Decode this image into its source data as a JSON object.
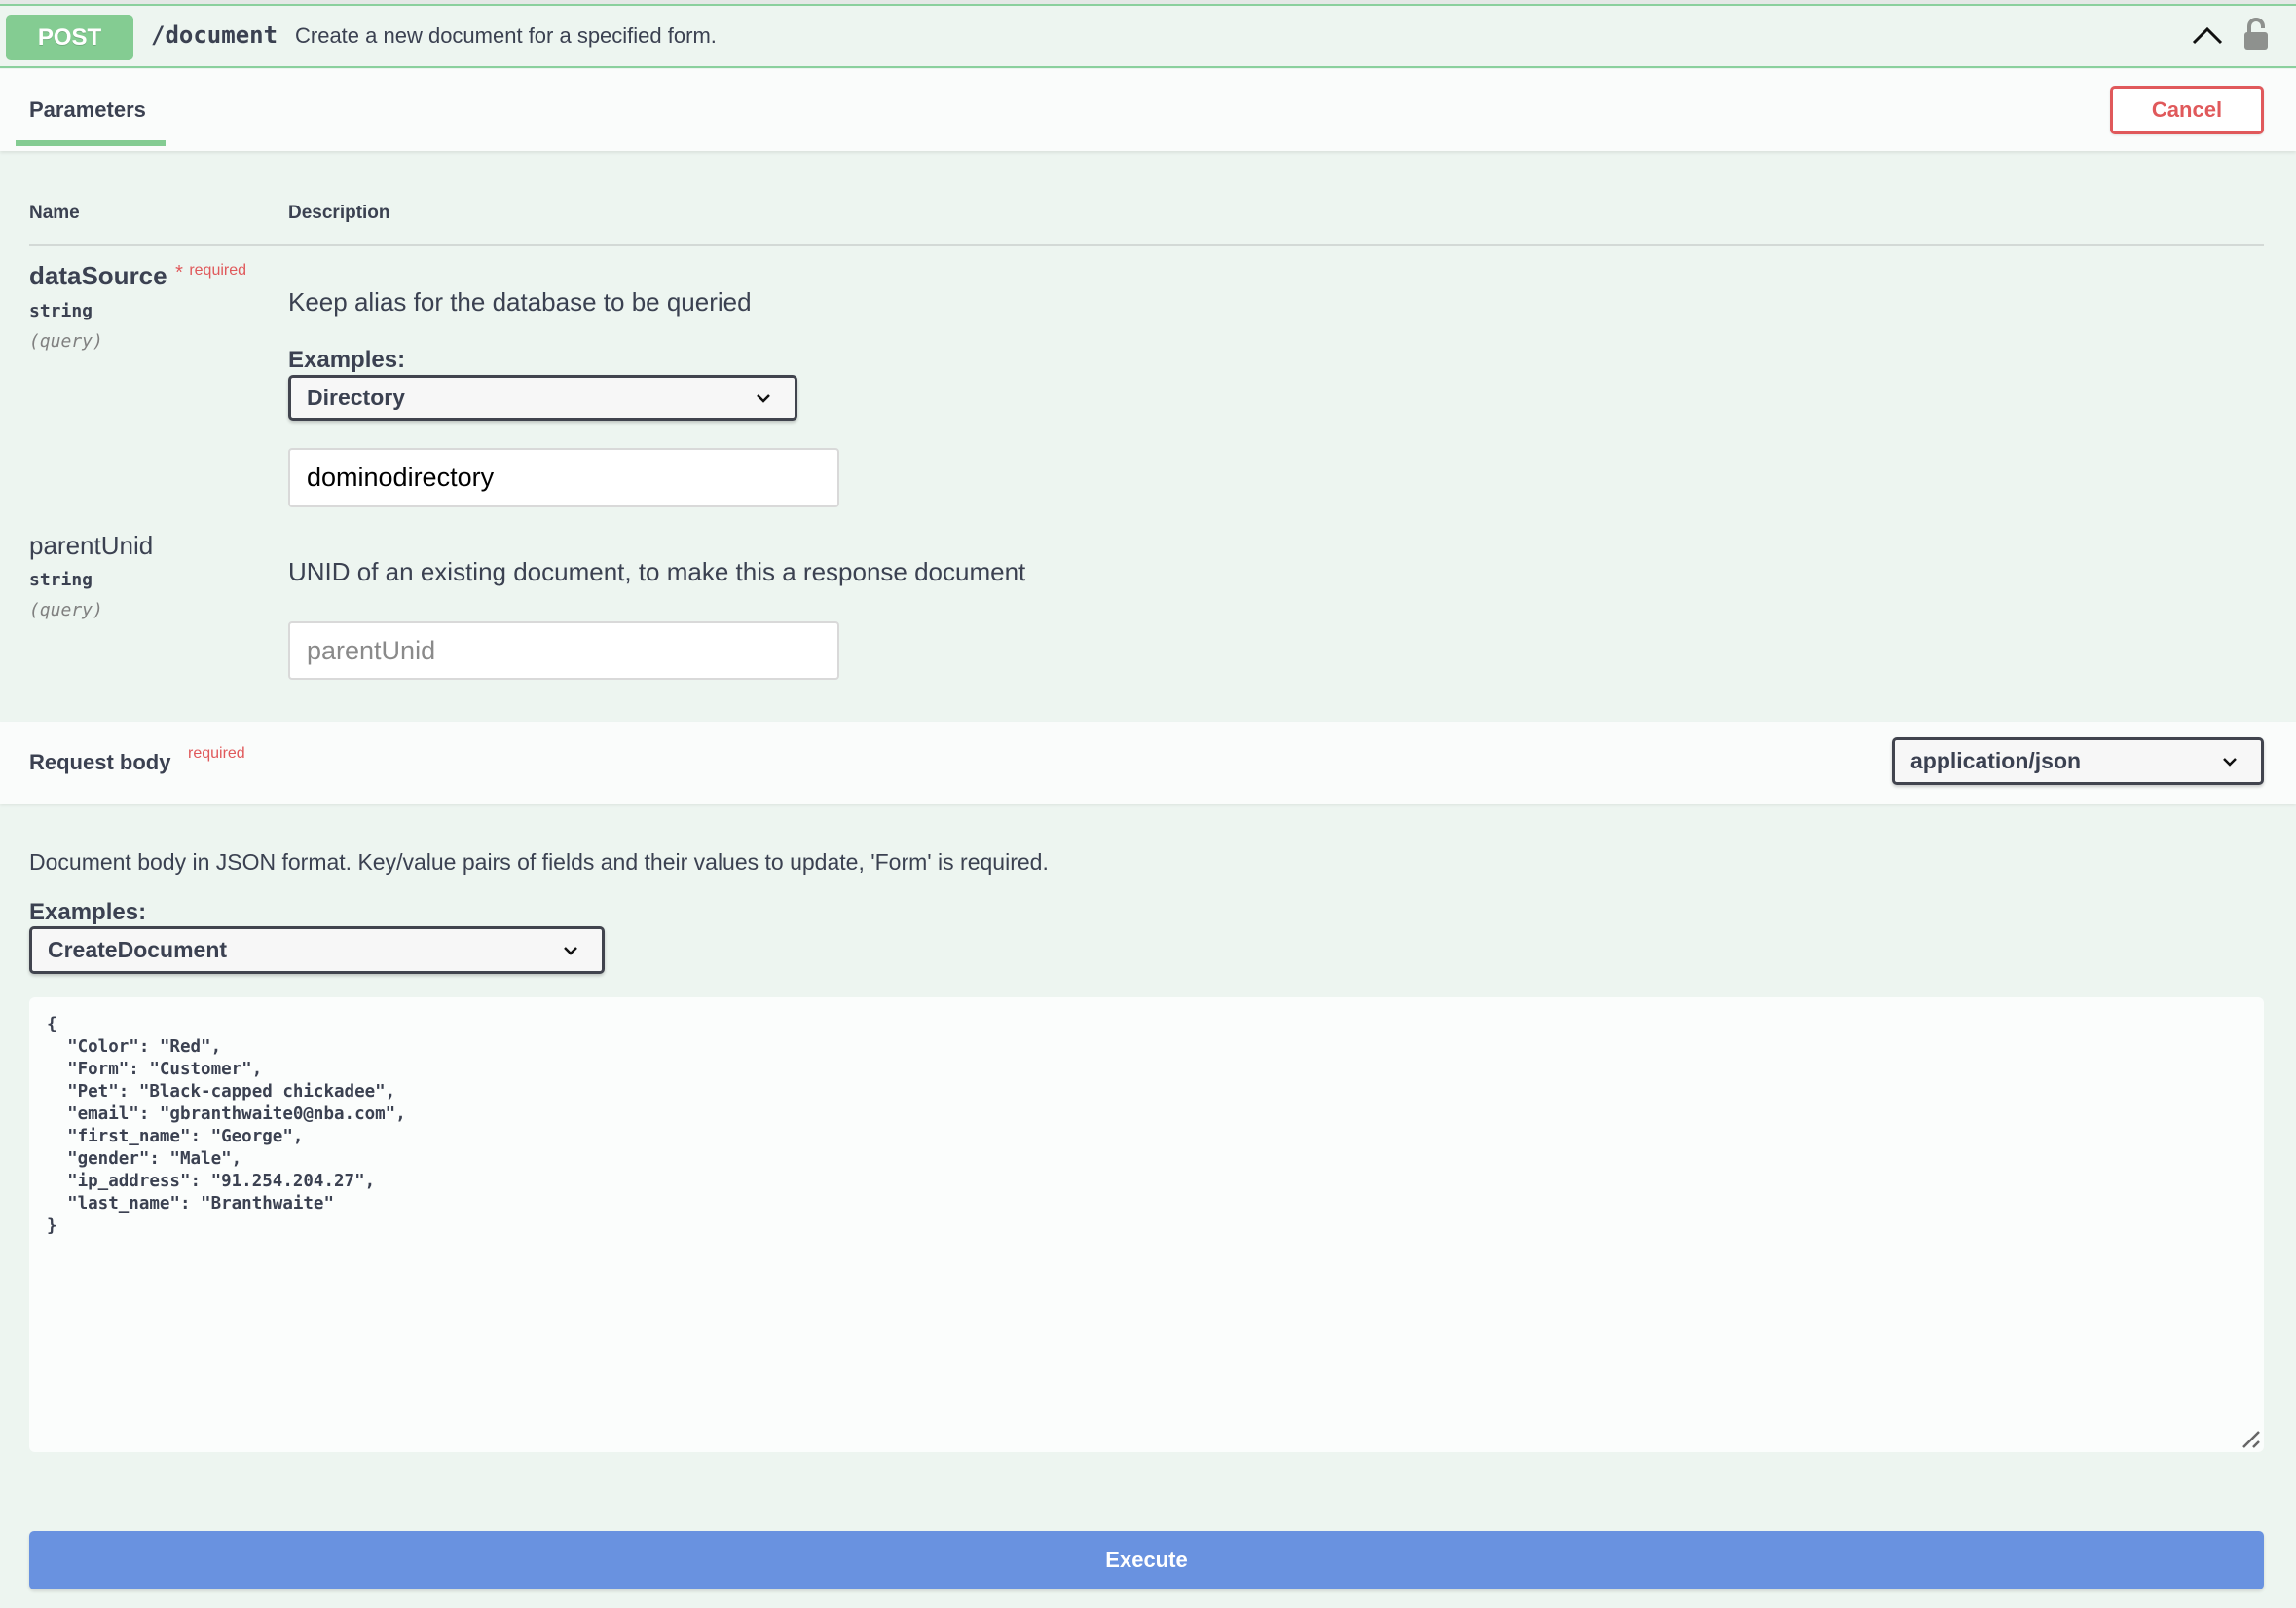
{
  "operation": {
    "method": "POST",
    "path": "/document",
    "summary": "Create a new document for a specified form.",
    "method_color": "#84cc92",
    "collapse_icon": "chevron-up-icon",
    "lock_icon": "lock-icon"
  },
  "tabs": {
    "parameters_label": "Parameters",
    "cancel_label": "Cancel"
  },
  "table": {
    "col_name": "Name",
    "col_description": "Description"
  },
  "parameters": [
    {
      "name": "dataSource",
      "required_star": "*",
      "required_label": "required",
      "type": "string",
      "in": "(query)",
      "description": "Keep alias for the database to be queried",
      "examples_label": "Examples:",
      "example_selected": "Directory",
      "value": "dominodirectory"
    },
    {
      "name": "parentUnid",
      "type": "string",
      "in": "(query)",
      "description": "UNID of an existing document, to make this a response document",
      "placeholder": "parentUnid",
      "value": ""
    }
  ],
  "request_body": {
    "title": "Request body",
    "required_label": "required",
    "content_type": "application/json",
    "description": "Document body in JSON format. Key/value pairs of fields and their values to update, 'Form' is required.",
    "examples_label": "Examples:",
    "example_selected": "CreateDocument",
    "body_text": "{\n  \"Color\": \"Red\",\n  \"Form\": \"Customer\",\n  \"Pet\": \"Black-capped chickadee\",\n  \"email\": \"gbranthwaite0@nba.com\",\n  \"first_name\": \"George\",\n  \"gender\": \"Male\",\n  \"ip_address\": \"91.254.204.27\",\n  \"last_name\": \"Branthwaite\"\n}"
  },
  "actions": {
    "execute_label": "Execute",
    "execute_color": "#6992e0"
  }
}
